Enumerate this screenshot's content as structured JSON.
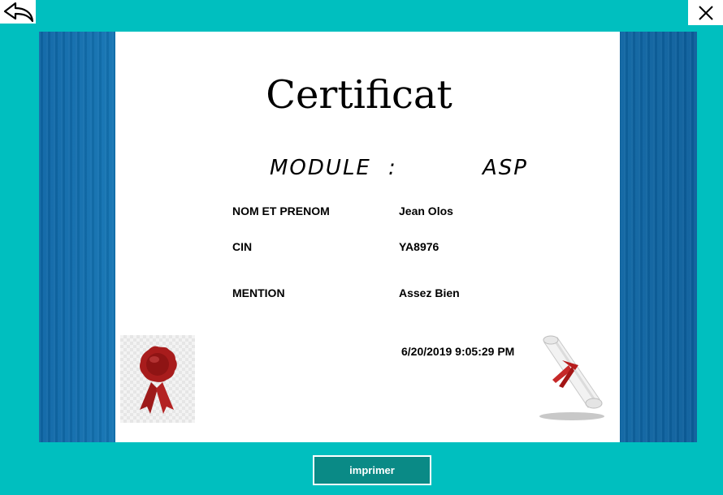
{
  "window": {
    "back_icon": "back-arrow-icon",
    "close_icon": "close-icon"
  },
  "certificate": {
    "title": "Certificat",
    "module_label": "MODULE",
    "module_separator": ":",
    "module_value": "ASP",
    "fields": [
      {
        "label": "NOM ET PRENOM",
        "value": "Jean Olos"
      },
      {
        "label": "CIN",
        "value": "YA8976"
      },
      {
        "label": "MENTION",
        "value": "Assez Bien"
      }
    ],
    "datetime": "6/20/2019 9:05:29 PM",
    "seal_icon": "wax-seal-icon",
    "scroll_icon": "diploma-scroll-icon"
  },
  "actions": {
    "print_label": "imprimer"
  },
  "colors": {
    "background": "#00bfbf",
    "side_panel": "#1579b6",
    "button": "#0a8a86",
    "seal_red": "#a81c1c"
  }
}
